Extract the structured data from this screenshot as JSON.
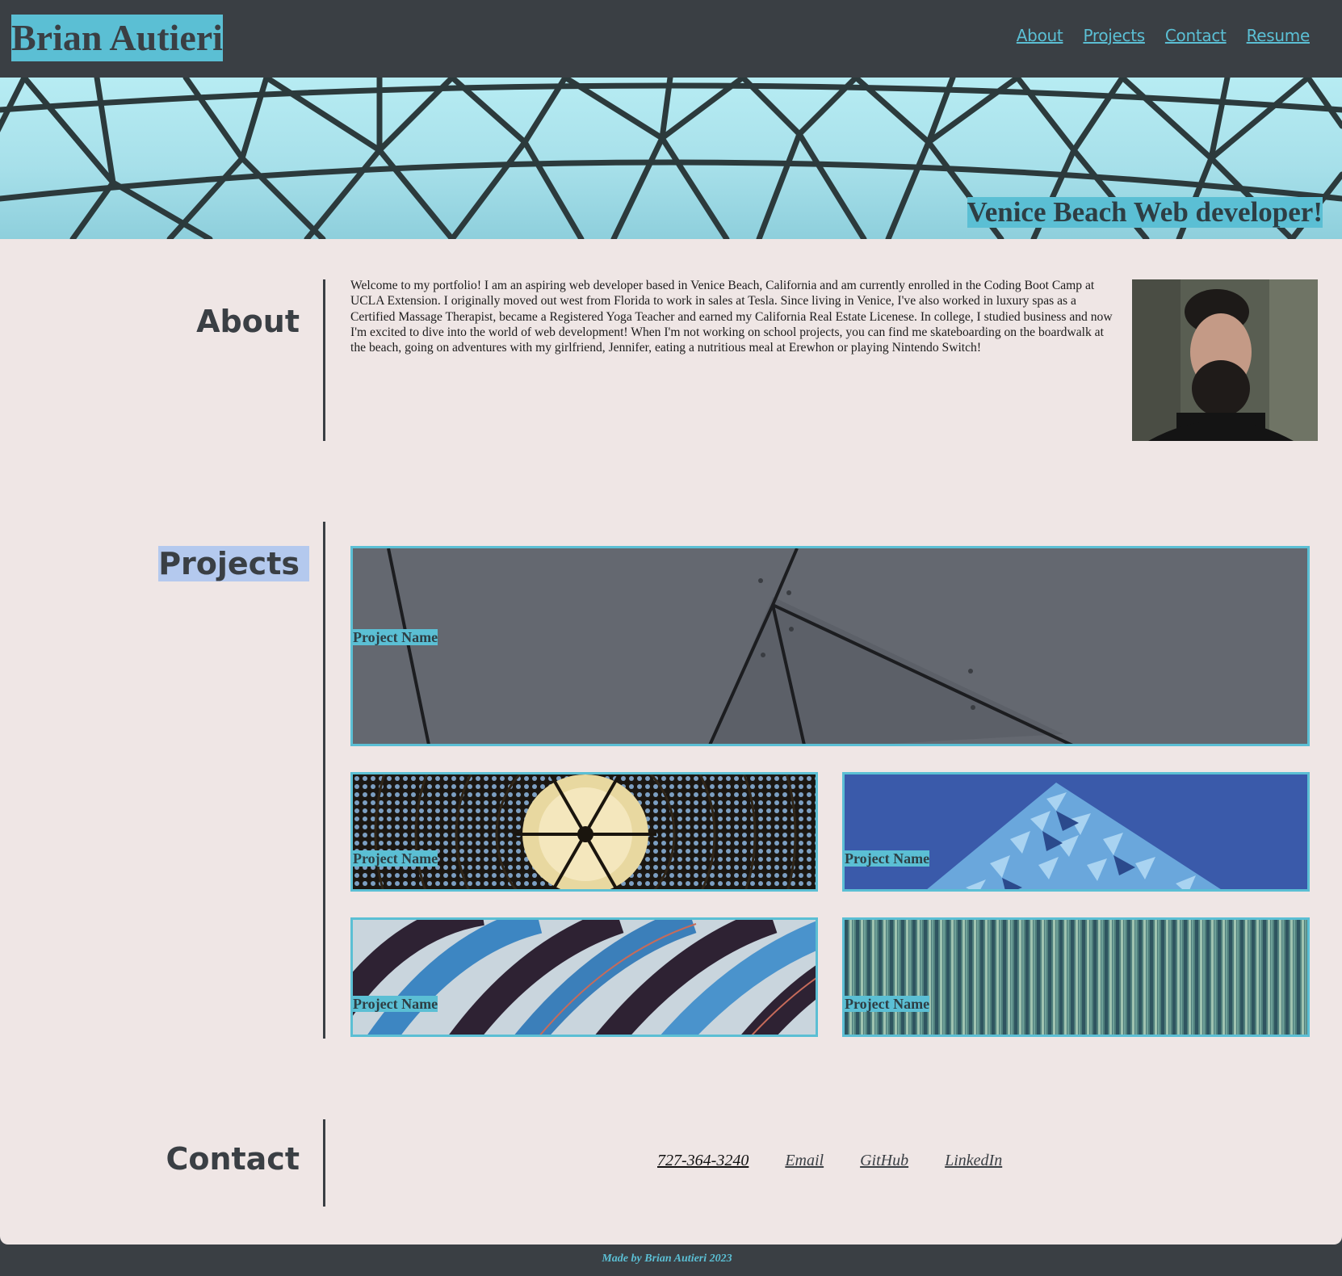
{
  "header": {
    "brand": "Brian Autieri",
    "nav": [
      "About",
      "Projects",
      "Contact",
      "Resume"
    ]
  },
  "hero": {
    "caption": "Venice Beach Web developer!"
  },
  "about": {
    "title": "About",
    "text": "Welcome to my portfolio! I am an aspiring web developer based in Venice Beach, California and am currently enrolled in the Coding Boot Camp at UCLA Extension. I originally moved out west from Florida to work in sales at Tesla. Since living in Venice, I've also worked in luxury spas as a Certified Massage Therapist, became a Registered Yoga Teacher and earned my California Real Estate Licenese. In college, I studied business and now I'm excited to dive into the world of web development! When I'm not working on school projects, you can find me skateboarding on the boardwalk at the beach, going on adventures with my girlfriend, Jennifer, eating a nutritious meal at Erewhon or playing Nintendo Switch!"
  },
  "projects": {
    "title": "Projects",
    "items": [
      {
        "label": "Project Name",
        "image": "gray-architecture"
      },
      {
        "label": "Project Name",
        "image": "stained-glass-dome"
      },
      {
        "label": "Project Name",
        "image": "blue-geometric-building"
      },
      {
        "label": "Project Name",
        "image": "blue-striped-abstract"
      },
      {
        "label": "Project Name",
        "image": "teal-vertical-stripes"
      }
    ]
  },
  "contact": {
    "title": "Contact",
    "links": [
      "727-364-3240",
      "Email",
      "GitHub",
      "LinkedIn"
    ]
  },
  "footer": {
    "text": "Made by Brian Autieri 2023"
  },
  "colors": {
    "accent": "#5bbfd4",
    "dark": "#3a3f44",
    "background": "#efe6e5",
    "highlight": "#b4c9ee"
  }
}
